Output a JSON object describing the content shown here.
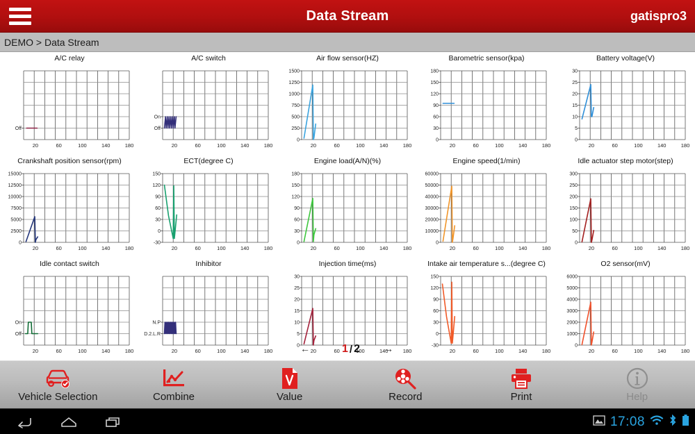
{
  "titlebar": {
    "menu_icon": "hamburger-icon",
    "title": "Data Stream",
    "user": "gatispro3",
    "bg_color": "#b00f0f"
  },
  "breadcrumb": {
    "text": "DEMO > Data Stream"
  },
  "pager": {
    "prev_arrow": "←",
    "current": "1",
    "separator": "/",
    "total": "2",
    "next_arrow": "→"
  },
  "toolbar": {
    "items": [
      {
        "label": "Vehicle Selection",
        "icon": "car-check-icon",
        "disabled": false
      },
      {
        "label": "Combine",
        "icon": "line-chart-icon",
        "disabled": false
      },
      {
        "label": "Value",
        "icon": "value-document-icon",
        "disabled": false
      },
      {
        "label": "Record",
        "icon": "record-reel-search-icon",
        "disabled": false
      },
      {
        "label": "Print",
        "icon": "printer-icon",
        "disabled": false
      },
      {
        "label": "Help",
        "icon": "info-circle-icon",
        "disabled": true
      }
    ],
    "accent_color": "#e02020"
  },
  "navbar": {
    "back_icon": "back-arrow-icon",
    "home_icon": "home-icon",
    "recents_icon": "recent-apps-icon",
    "screenshot_icon": "image-icon",
    "time": "17:08",
    "wifi_icon": "wifi-icon",
    "bluetooth_icon": "bluetooth-icon",
    "battery_icon": "battery-icon",
    "accent_color": "#2aa4e0"
  },
  "chart_data": [
    {
      "type": "line",
      "title": "A/C relay",
      "color": "#8e2346",
      "xlabel": "",
      "ylabel": "",
      "xlim": [
        0,
        180
      ],
      "xticks": [
        20,
        60,
        100,
        140,
        180
      ],
      "ylim": [
        0,
        6
      ],
      "yticks": [
        ""
      ],
      "ytick_labels": [
        "Off"
      ],
      "ytick_values": [
        1
      ],
      "grid": true,
      "x": [
        5,
        10,
        15,
        20,
        23
      ],
      "values": [
        1,
        1,
        1,
        1,
        1
      ]
    },
    {
      "type": "line",
      "title": "A/C switch",
      "color": "#332f7a",
      "xlim": [
        0,
        180
      ],
      "xticks": [
        20,
        60,
        100,
        140,
        180
      ],
      "ylim": [
        0,
        6
      ],
      "ytick_labels": [
        "On",
        "Off"
      ],
      "ytick_values": [
        2,
        1
      ],
      "grid": true,
      "x": [
        3,
        5,
        6,
        8,
        9,
        11,
        12,
        14,
        15,
        17,
        18,
        20,
        21,
        23
      ],
      "values": [
        1,
        2,
        1,
        2,
        1,
        2,
        1,
        2,
        1,
        2,
        1,
        2,
        1,
        2
      ]
    },
    {
      "type": "line",
      "title": "Air flow sensor(HZ)",
      "color": "#3aa3de",
      "xlim": [
        0,
        180
      ],
      "xticks": [
        20,
        60,
        100,
        140,
        180
      ],
      "ylim": [
        0,
        1500
      ],
      "ytick_labels": [
        "0",
        "250",
        "500",
        "750",
        "1000",
        "1250",
        "1500"
      ],
      "ytick_values": [
        0,
        250,
        500,
        750,
        1000,
        1250,
        1500
      ],
      "grid": true,
      "x": [
        4,
        19,
        20,
        21,
        24
      ],
      "values": [
        30,
        1190,
        0,
        40,
        340
      ]
    },
    {
      "type": "line",
      "title": "Barometric sensor(kpa)",
      "color": "#2f8fd8",
      "xlim": [
        0,
        180
      ],
      "xticks": [
        20,
        60,
        100,
        140,
        180
      ],
      "ylim": [
        0,
        180
      ],
      "ytick_labels": [
        "0",
        "30",
        "60",
        "90",
        "120",
        "150",
        "180"
      ],
      "ytick_values": [
        0,
        30,
        60,
        90,
        120,
        150,
        180
      ],
      "grid": true,
      "x": [
        4,
        23
      ],
      "values": [
        95,
        95
      ]
    },
    {
      "type": "line",
      "title": "Battery voltage(V)",
      "color": "#2f8fd8",
      "xlim": [
        0,
        180
      ],
      "xticks": [
        20,
        60,
        100,
        140,
        180
      ],
      "ylim": [
        0,
        30
      ],
      "ytick_labels": [
        "0",
        "5",
        "10",
        "15",
        "20",
        "25",
        "30"
      ],
      "ytick_values": [
        0,
        5,
        10,
        15,
        20,
        25,
        30
      ],
      "grid": true,
      "x": [
        4,
        19,
        20,
        21,
        24
      ],
      "values": [
        9,
        24,
        10,
        10,
        14
      ]
    },
    {
      "type": "line",
      "title": "Crankshaft position sensor(rpm)",
      "color": "#23357a",
      "xlim": [
        0,
        180
      ],
      "xticks": [
        20,
        60,
        100,
        140,
        180
      ],
      "ylim": [
        0,
        15000
      ],
      "ytick_labels": [
        "0",
        "2500",
        "5000",
        "7500",
        "10000",
        "12500",
        "15000"
      ],
      "ytick_values": [
        0,
        2500,
        5000,
        7500,
        10000,
        12500,
        15000
      ],
      "grid": true,
      "x": [
        4,
        19,
        20,
        21,
        24
      ],
      "values": [
        150,
        5600,
        0,
        600,
        1200
      ]
    },
    {
      "type": "line",
      "title": "ECT(degree C)",
      "color": "#18a06f",
      "xlim": [
        0,
        180
      ],
      "xticks": [
        20,
        60,
        100,
        140,
        180
      ],
      "ylim": [
        -30,
        150
      ],
      "ytick_labels": [
        "-30",
        "0",
        "30",
        "60",
        "90",
        "120",
        "150"
      ],
      "ytick_values": [
        -30,
        0,
        30,
        60,
        90,
        120,
        150
      ],
      "grid": true,
      "x": [
        3,
        10,
        18,
        19,
        20,
        24
      ],
      "values": [
        120,
        40,
        -20,
        118,
        -20,
        42
      ]
    },
    {
      "type": "line",
      "title": "Engine load(A/N)(%)",
      "color": "#3cc63c",
      "xlim": [
        0,
        180
      ],
      "xticks": [
        20,
        60,
        100,
        140,
        180
      ],
      "ylim": [
        0,
        180
      ],
      "ytick_labels": [
        "0",
        "30",
        "60",
        "90",
        "120",
        "150",
        "180"
      ],
      "ytick_values": [
        0,
        30,
        60,
        90,
        120,
        150,
        180
      ],
      "grid": true,
      "x": [
        4,
        19,
        20,
        21,
        24
      ],
      "values": [
        2,
        115,
        2,
        20,
        36
      ]
    },
    {
      "type": "line",
      "title": "Engine speed(1/min)",
      "color": "#f0952a",
      "xlim": [
        0,
        180
      ],
      "xticks": [
        20,
        60,
        100,
        140,
        180
      ],
      "ylim": [
        0,
        60000
      ],
      "ytick_labels": [
        "0",
        "10000",
        "20000",
        "30000",
        "40000",
        "50000",
        "60000"
      ],
      "ytick_values": [
        0,
        10000,
        20000,
        30000,
        40000,
        50000,
        60000
      ],
      "grid": true,
      "x": [
        4,
        19,
        20,
        21,
        24
      ],
      "values": [
        1000,
        49000,
        0,
        3000,
        14500
      ]
    },
    {
      "type": "line",
      "title": "Idle actuator step motor(step)",
      "color": "#a32020",
      "xlim": [
        0,
        180
      ],
      "xticks": [
        20,
        60,
        100,
        140,
        180
      ],
      "ylim": [
        0,
        300
      ],
      "ytick_labels": [
        "0",
        "50",
        "100",
        "150",
        "200",
        "250",
        "300"
      ],
      "ytick_values": [
        0,
        50,
        100,
        150,
        200,
        250,
        300
      ],
      "grid": true,
      "x": [
        4,
        19,
        20,
        21,
        24
      ],
      "values": [
        2,
        190,
        0,
        10,
        52
      ]
    },
    {
      "type": "line",
      "title": "Idle contact switch",
      "color": "#0f6b34",
      "xlim": [
        0,
        180
      ],
      "xticks": [
        20,
        60,
        100,
        140,
        180
      ],
      "ylim": [
        0,
        6
      ],
      "ytick_labels": [
        "On",
        "Off"
      ],
      "ytick_values": [
        2,
        1
      ],
      "grid": true,
      "x": [
        3,
        7,
        8,
        13,
        14,
        24
      ],
      "values": [
        1,
        1,
        2,
        2,
        1,
        1
      ]
    },
    {
      "type": "line",
      "title": "Inhibitor",
      "color": "#332f7a",
      "xlim": [
        0,
        180
      ],
      "xticks": [
        20,
        60,
        100,
        140,
        180
      ],
      "ylim": [
        0,
        6
      ],
      "ytick_labels": [
        "N.P",
        "D.2.L.R"
      ],
      "ytick_values": [
        2,
        1
      ],
      "grid": true,
      "x": [
        3,
        4,
        5,
        6,
        7,
        8,
        9,
        10,
        11,
        12,
        13,
        14,
        15,
        16,
        17,
        18,
        19,
        20,
        21,
        22,
        23
      ],
      "values": [
        1,
        2,
        1,
        2,
        1,
        2,
        1,
        2,
        1,
        2,
        1,
        2,
        1,
        2,
        1,
        2,
        1,
        2,
        1,
        2,
        1
      ]
    },
    {
      "type": "line",
      "title": "Injection time(ms)",
      "color": "#a3203a",
      "xlim": [
        0,
        180
      ],
      "xticks": [
        20,
        60,
        100,
        140,
        180
      ],
      "ylim": [
        0,
        30
      ],
      "ytick_labels": [
        "0",
        "5",
        "10",
        "15",
        "20",
        "25",
        "30"
      ],
      "ytick_values": [
        0,
        5,
        10,
        15,
        20,
        25,
        30
      ],
      "grid": true,
      "x": [
        4,
        19,
        20,
        21,
        24
      ],
      "values": [
        0.5,
        16,
        0,
        2,
        4
      ]
    },
    {
      "type": "line",
      "title": "Intake air temperature s...(degree C)",
      "color": "#f05a28",
      "xlim": [
        0,
        180
      ],
      "xticks": [
        20,
        60,
        100,
        140,
        180
      ],
      "ylim": [
        -30,
        150
      ],
      "ytick_labels": [
        "-30",
        "0",
        "30",
        "60",
        "90",
        "120",
        "150"
      ],
      "ytick_values": [
        -30,
        0,
        30,
        60,
        90,
        120,
        150
      ],
      "grid": true,
      "x": [
        3,
        10,
        18,
        19,
        20,
        24
      ],
      "values": [
        130,
        45,
        -25,
        135,
        -25,
        45
      ]
    },
    {
      "type": "line",
      "title": "O2 sensor(mV)",
      "color": "#f0502a",
      "xlim": [
        0,
        180
      ],
      "xticks": [
        20,
        60,
        100,
        140,
        180
      ],
      "ylim": [
        0,
        6000
      ],
      "ytick_labels": [
        "0",
        "1000",
        "2000",
        "3000",
        "4000",
        "5000",
        "6000"
      ],
      "ytick_values": [
        0,
        1000,
        2000,
        3000,
        4000,
        5000,
        6000
      ],
      "grid": true,
      "x": [
        4,
        19,
        20,
        21,
        24
      ],
      "values": [
        50,
        3750,
        0,
        250,
        1150
      ]
    }
  ]
}
